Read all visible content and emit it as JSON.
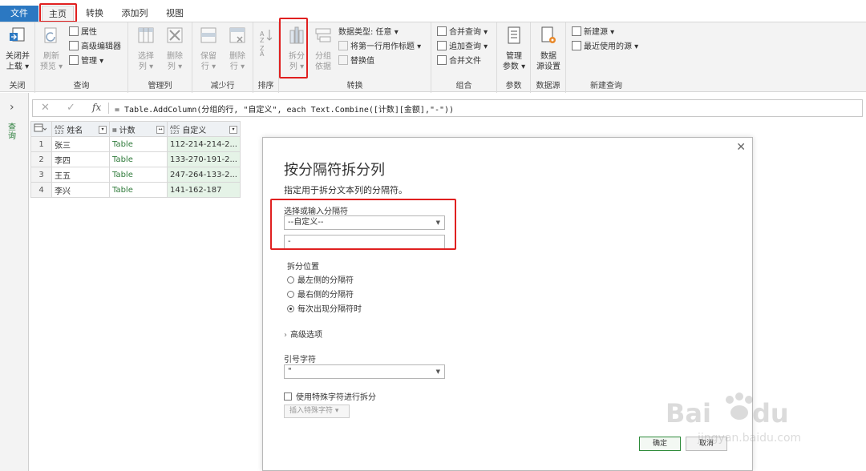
{
  "tabs": {
    "file": "文件",
    "home": "主页",
    "transform": "转换",
    "add_column": "添加列",
    "view": "视图"
  },
  "ribbon": {
    "close_group": {
      "label": "关闭",
      "close_load_line1": "关闭并",
      "close_load_line2": "上载 ▾"
    },
    "query_group": {
      "label": "查询",
      "refresh_line1": "刷新",
      "refresh_line2": "预览 ▾",
      "properties": "属性",
      "advanced_editor": "高级编辑器",
      "manage": "管理 ▾"
    },
    "manage_cols_group": {
      "label": "管理列",
      "choose_line1": "选择",
      "choose_line2": "列 ▾",
      "remove_line1": "删除",
      "remove_line2": "列 ▾"
    },
    "reduce_rows_group": {
      "label": "减少行",
      "keep_line1": "保留",
      "keep_line2": "行 ▾",
      "remove_line1": "删除",
      "remove_line2": "行 ▾"
    },
    "sort_group": {
      "label": "排序"
    },
    "transform_group": {
      "label": "转换",
      "split_line1": "拆分",
      "split_line2": "列 ▾",
      "groupby_line1": "分组",
      "groupby_line2": "依据",
      "data_type": "数据类型: 任意 ▾",
      "first_row_header": "将第一行用作标题 ▾",
      "replace_values": "替换值"
    },
    "combine_group": {
      "label": "组合",
      "merge_queries": "合并查询 ▾",
      "append_queries": "追加查询 ▾",
      "combine_files": "合并文件"
    },
    "params_group": {
      "label": "参数",
      "manage_line1": "管理",
      "manage_line2": "参数 ▾"
    },
    "datasource_group": {
      "label": "数据源",
      "settings_line1": "数据",
      "settings_line2": "源设置"
    },
    "newquery_group": {
      "label": "新建查询",
      "new_source": "新建源 ▾",
      "recent_sources": "最近使用的源 ▾"
    }
  },
  "left_pane": {
    "queries_label": "查询"
  },
  "formula_bar": {
    "fx": "fx",
    "formula": "= Table.AddColumn(分组的行, \"自定义\", each Text.Combine([计数][金额],\"-\"))"
  },
  "grid": {
    "headers": [
      "姓名",
      "计数",
      "自定义"
    ],
    "rows": [
      {
        "num": "1",
        "name": "张三",
        "count": "Table",
        "custom": "112-214-214-2..."
      },
      {
        "num": "2",
        "name": "李四",
        "count": "Table",
        "custom": "133-270-191-2..."
      },
      {
        "num": "3",
        "name": "王五",
        "count": "Table",
        "custom": "247-264-133-2..."
      },
      {
        "num": "4",
        "name": "李兴",
        "count": "Table",
        "custom": "141-162-187"
      }
    ]
  },
  "dialog": {
    "title": "按分隔符拆分列",
    "subtitle": "指定用于拆分文本列的分隔符。",
    "delimiter_label": "选择或输入分隔符",
    "delimiter_value": "--自定义--",
    "custom_delimiter": "-",
    "split_at_label": "拆分位置",
    "split_options": [
      "最左侧的分隔符",
      "最右侧的分隔符",
      "每次出现分隔符时"
    ],
    "selected_option_index": 2,
    "advanced_label": "高级选项",
    "quote_label": "引号字符",
    "quote_value": "\"",
    "special_chars_label": "使用特殊字符进行拆分",
    "insert_special_label": "插入特殊字符 ▾",
    "ok_label": "确定",
    "cancel_label": "取消"
  },
  "colors": {
    "file_tab": "#2b78c2",
    "highlight": "#e02020",
    "custom_col_bg": "#e5f3e7",
    "table_text": "#2f7a3a"
  }
}
